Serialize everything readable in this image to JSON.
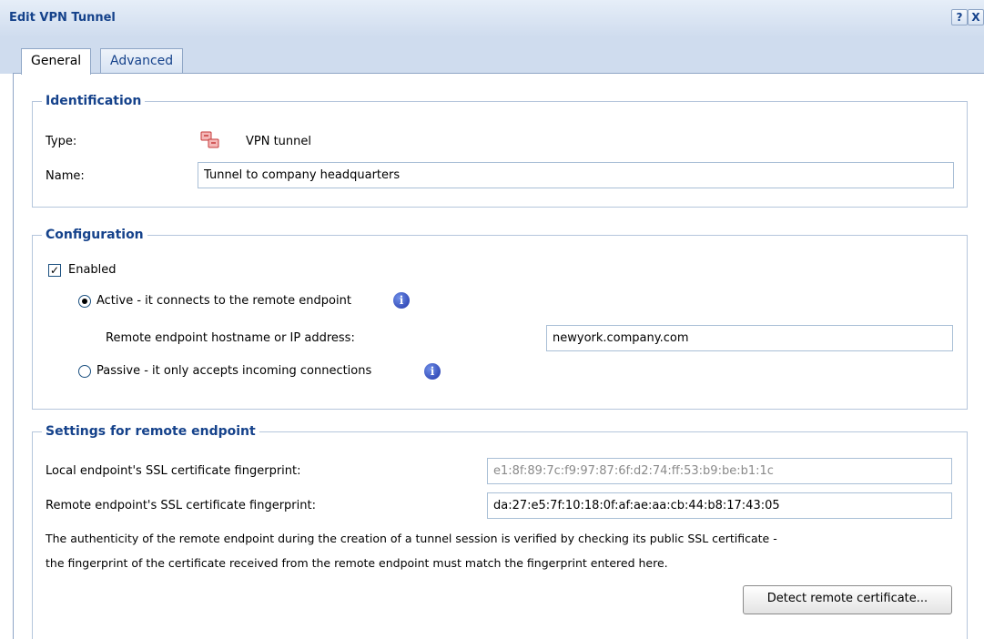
{
  "window": {
    "title": "Edit VPN Tunnel",
    "help_label": "?",
    "close_label": "X"
  },
  "tabs": [
    {
      "label": "General",
      "active": true
    },
    {
      "label": "Advanced",
      "active": false
    }
  ],
  "identification": {
    "legend": "Identification",
    "type_label": "Type:",
    "type_value": "VPN tunnel",
    "type_icon": "vpn-tunnel-icon",
    "name_label": "Name:",
    "name_value": "Tunnel to company headquarters"
  },
  "configuration": {
    "legend": "Configuration",
    "enabled_label": "Enabled",
    "enabled_checked": true,
    "active_label": "Active - it connects to the remote endpoint",
    "active_selected": true,
    "remote_host_label": "Remote endpoint hostname or IP address:",
    "remote_host_value": "newyork.company.com",
    "passive_label": "Passive - it only accepts incoming connections",
    "passive_selected": false
  },
  "remote_settings": {
    "legend": "Settings for remote endpoint",
    "local_fp_label": "Local endpoint's SSL certificate fingerprint:",
    "local_fp_value": "e1:8f:89:7c:f9:97:87:6f:d2:74:ff:53:b9:be:b1:1c",
    "remote_fp_label": "Remote endpoint's SSL certificate fingerprint:",
    "remote_fp_value": "da:27:e5:7f:10:18:0f:af:ae:aa:cb:44:b8:17:43:05",
    "description_line1": "The authenticity of the remote endpoint during the creation of a tunnel session is verified by checking its public SSL certificate -",
    "description_line2": "the fingerprint of the certificate received from the remote endpoint must match the fingerprint entered here.",
    "detect_button": "Detect remote certificate..."
  },
  "colors": {
    "title": "#15428b",
    "frame": "#8fa6c6",
    "info_icon": "#2035a8"
  }
}
